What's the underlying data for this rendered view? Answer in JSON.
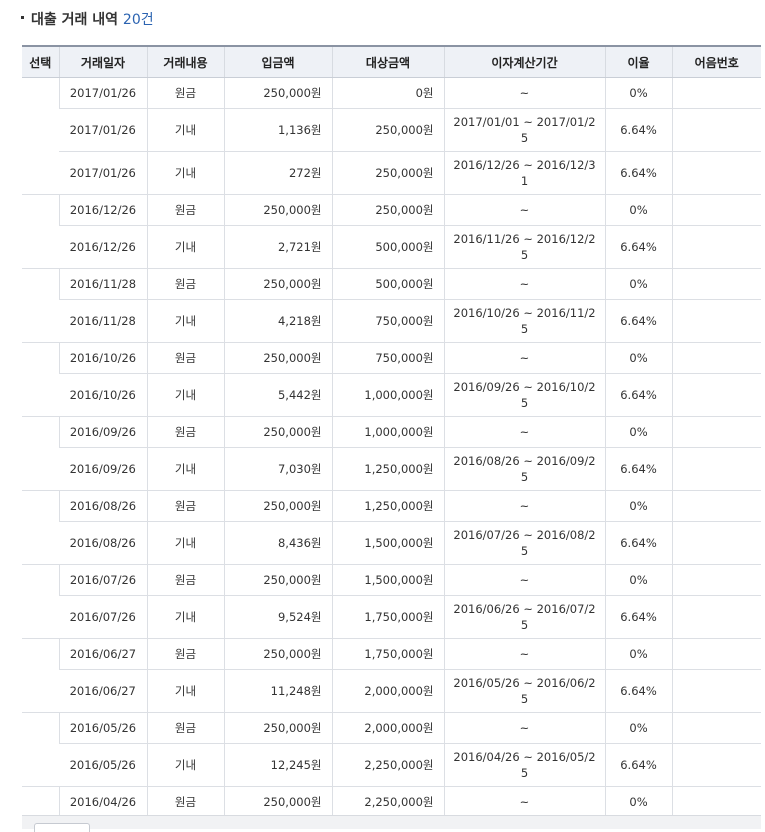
{
  "section": {
    "title": "대출 거래 내역",
    "count": "20건"
  },
  "columns": [
    "선택",
    "거래일자",
    "거래내용",
    "입금액",
    "대상금액",
    "이자계산기간",
    "이율",
    "어음번호"
  ],
  "groups": [
    {
      "rows": [
        {
          "date": "2017/01/26",
          "type": "원금",
          "deposit": "250,000원",
          "target": "0원",
          "period": "~",
          "rate": "0%",
          "note": ""
        },
        {
          "date": "2017/01/26",
          "type": "기내",
          "deposit": "1,136원",
          "target": "250,000원",
          "period": "2017/01/01 ~ 2017/01/25",
          "rate": "6.64%",
          "note": ""
        },
        {
          "date": "2017/01/26",
          "type": "기내",
          "deposit": "272원",
          "target": "250,000원",
          "period": "2016/12/26 ~ 2016/12/31",
          "rate": "6.64%",
          "note": ""
        }
      ]
    },
    {
      "rows": [
        {
          "date": "2016/12/26",
          "type": "원금",
          "deposit": "250,000원",
          "target": "250,000원",
          "period": "~",
          "rate": "0%",
          "note": ""
        },
        {
          "date": "2016/12/26",
          "type": "기내",
          "deposit": "2,721원",
          "target": "500,000원",
          "period": "2016/11/26 ~ 2016/12/25",
          "rate": "6.64%",
          "note": ""
        }
      ]
    },
    {
      "rows": [
        {
          "date": "2016/11/28",
          "type": "원금",
          "deposit": "250,000원",
          "target": "500,000원",
          "period": "~",
          "rate": "0%",
          "note": ""
        },
        {
          "date": "2016/11/28",
          "type": "기내",
          "deposit": "4,218원",
          "target": "750,000원",
          "period": "2016/10/26 ~ 2016/11/25",
          "rate": "6.64%",
          "note": ""
        }
      ]
    },
    {
      "rows": [
        {
          "date": "2016/10/26",
          "type": "원금",
          "deposit": "250,000원",
          "target": "750,000원",
          "period": "~",
          "rate": "0%",
          "note": ""
        },
        {
          "date": "2016/10/26",
          "type": "기내",
          "deposit": "5,442원",
          "target": "1,000,000원",
          "period": "2016/09/26 ~ 2016/10/25",
          "rate": "6.64%",
          "note": ""
        }
      ]
    },
    {
      "rows": [
        {
          "date": "2016/09/26",
          "type": "원금",
          "deposit": "250,000원",
          "target": "1,000,000원",
          "period": "~",
          "rate": "0%",
          "note": ""
        },
        {
          "date": "2016/09/26",
          "type": "기내",
          "deposit": "7,030원",
          "target": "1,250,000원",
          "period": "2016/08/26 ~ 2016/09/25",
          "rate": "6.64%",
          "note": ""
        }
      ]
    },
    {
      "rows": [
        {
          "date": "2016/08/26",
          "type": "원금",
          "deposit": "250,000원",
          "target": "1,250,000원",
          "period": "~",
          "rate": "0%",
          "note": ""
        },
        {
          "date": "2016/08/26",
          "type": "기내",
          "deposit": "8,436원",
          "target": "1,500,000원",
          "period": "2016/07/26 ~ 2016/08/25",
          "rate": "6.64%",
          "note": ""
        }
      ]
    },
    {
      "rows": [
        {
          "date": "2016/07/26",
          "type": "원금",
          "deposit": "250,000원",
          "target": "1,500,000원",
          "period": "~",
          "rate": "0%",
          "note": ""
        },
        {
          "date": "2016/07/26",
          "type": "기내",
          "deposit": "9,524원",
          "target": "1,750,000원",
          "period": "2016/06/26 ~ 2016/07/25",
          "rate": "6.64%",
          "note": ""
        }
      ]
    },
    {
      "rows": [
        {
          "date": "2016/06/27",
          "type": "원금",
          "deposit": "250,000원",
          "target": "1,750,000원",
          "period": "~",
          "rate": "0%",
          "note": ""
        },
        {
          "date": "2016/06/27",
          "type": "기내",
          "deposit": "11,248원",
          "target": "2,000,000원",
          "period": "2016/05/26 ~ 2016/06/25",
          "rate": "6.64%",
          "note": ""
        }
      ]
    },
    {
      "rows": [
        {
          "date": "2016/05/26",
          "type": "원금",
          "deposit": "250,000원",
          "target": "2,000,000원",
          "period": "~",
          "rate": "0%",
          "note": ""
        },
        {
          "date": "2016/05/26",
          "type": "기내",
          "deposit": "12,245원",
          "target": "2,250,000원",
          "period": "2016/04/26 ~ 2016/05/25",
          "rate": "6.64%",
          "note": ""
        }
      ]
    },
    {
      "rows": [
        {
          "date": "2016/04/26",
          "type": "원금",
          "deposit": "250,000원",
          "target": "2,250,000원",
          "period": "~",
          "rate": "0%",
          "note": ""
        }
      ]
    }
  ]
}
